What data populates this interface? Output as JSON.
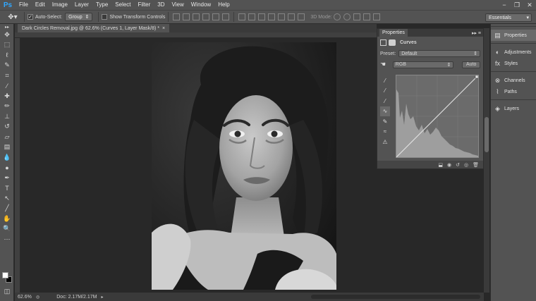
{
  "app": {
    "logo": "Ps"
  },
  "menu": [
    "File",
    "Edit",
    "Image",
    "Layer",
    "Type",
    "Select",
    "Filter",
    "3D",
    "View",
    "Window",
    "Help"
  ],
  "window_controls": {
    "minimize": "−",
    "restore": "❐",
    "close": "✕"
  },
  "options_bar": {
    "auto_select_label": "Auto-Select:",
    "auto_select_checked": true,
    "auto_select_value": "Group",
    "transform_label": "Show Transform Controls",
    "transform_checked": false,
    "mode_label": "3D Mode:",
    "workspace": "Essentials"
  },
  "document": {
    "tab_title": "Dark Circles Removal.jpg @ 62.6% (Curves 1, Layer Mask/8) *",
    "tab_close": "×",
    "zoom": "62.6%",
    "doc_size": "Doc: 2.17M/2.17M"
  },
  "properties": {
    "panel_title": "Properties",
    "adjustment_name": "Curves",
    "preset_label": "Preset:",
    "preset_value": "Default",
    "channel_value": "RGB",
    "auto_label": "Auto"
  },
  "dock": {
    "items": [
      {
        "label": "Properties",
        "icon": "properties-icon",
        "active": true
      },
      {
        "label": "Adjustments",
        "icon": "adjustments-icon",
        "active": false
      },
      {
        "label": "Styles",
        "icon": "styles-icon",
        "active": false
      },
      {
        "label": "Channels",
        "icon": "channels-icon",
        "active": false
      },
      {
        "label": "Paths",
        "icon": "paths-icon",
        "active": false
      },
      {
        "label": "Layers",
        "icon": "layers-icon",
        "active": false
      }
    ]
  },
  "colors": {
    "panel_bg": "#535353",
    "workspace_bg": "#282828",
    "accent": "#31a8ff",
    "foreground_swatch": "#ffffff",
    "background_swatch": "#000000"
  }
}
